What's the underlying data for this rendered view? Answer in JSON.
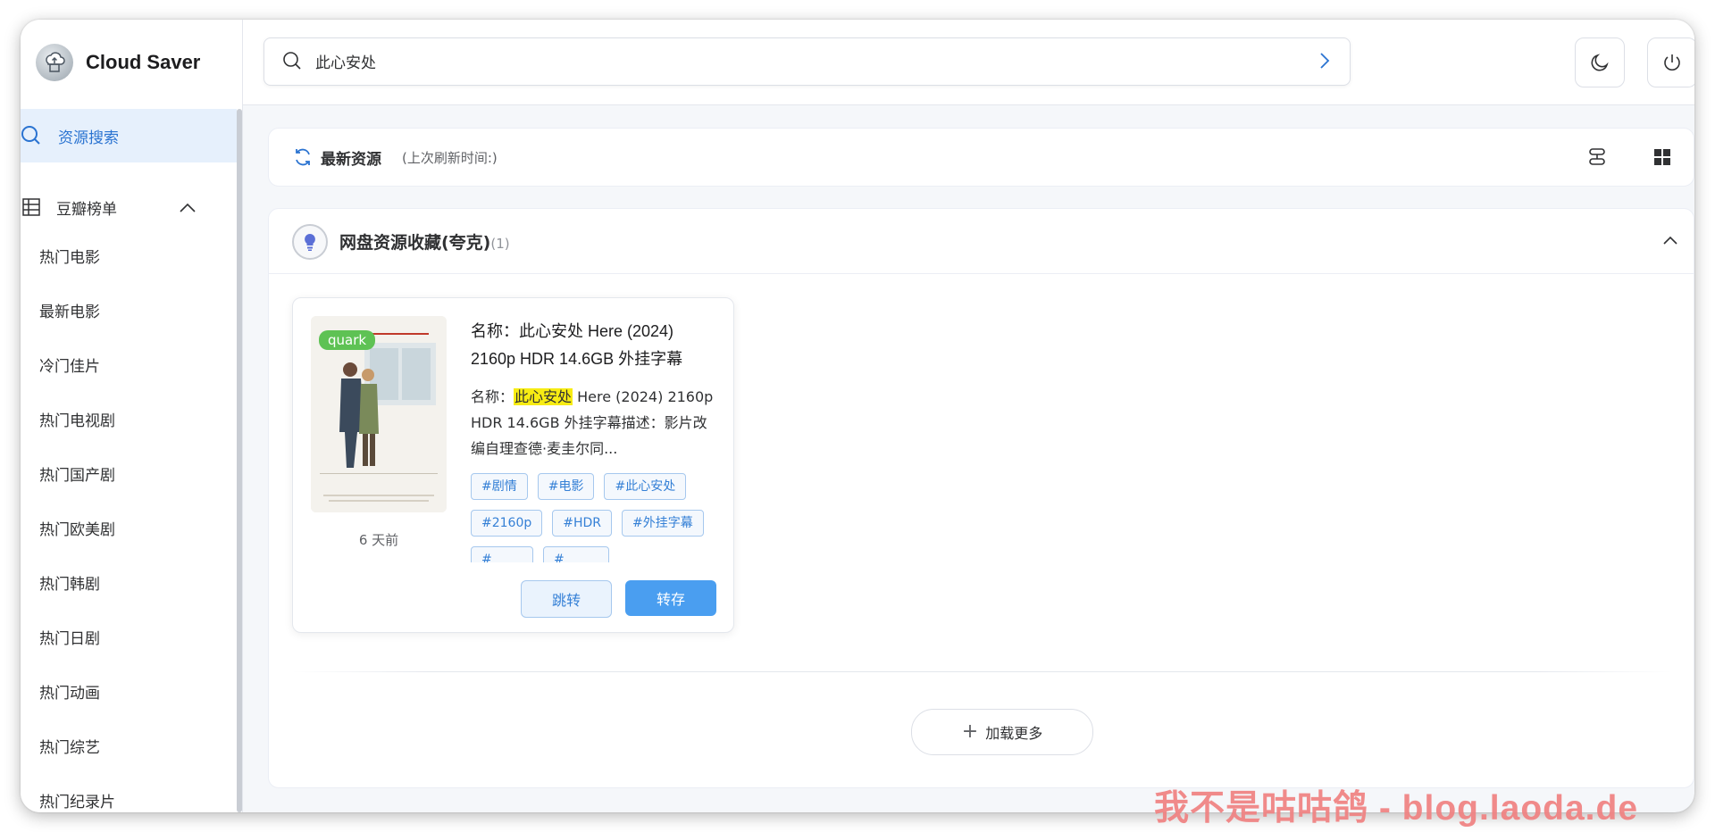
{
  "app": {
    "name": "Cloud Saver"
  },
  "sidebar": {
    "active": {
      "label": "资源搜索",
      "icon": "search-icon"
    },
    "group": {
      "label": "豆瓣榜单",
      "icon": "table-icon",
      "expanded": true
    },
    "items": [
      {
        "label": "热门电影"
      },
      {
        "label": "最新电影"
      },
      {
        "label": "冷门佳片"
      },
      {
        "label": "热门电视剧"
      },
      {
        "label": "热门国产剧"
      },
      {
        "label": "热门欧美剧"
      },
      {
        "label": "热门韩剧"
      },
      {
        "label": "热门日剧"
      },
      {
        "label": "热门动画"
      },
      {
        "label": "热门综艺"
      },
      {
        "label": "热门纪录片"
      }
    ]
  },
  "search": {
    "value": "此心安处"
  },
  "header_buttons": {
    "theme": "moon-icon",
    "logout": "power-icon"
  },
  "latest": {
    "title": "最新资源",
    "subtitle": "(上次刷新时间:)"
  },
  "panel": {
    "title": "网盘资源收藏(夸克)",
    "count": "(1)",
    "result": {
      "badge": "quark",
      "age": "6 天前",
      "title": "名称：此心安处 Here (2024) 2160p HDR 14.6GB 外挂字幕",
      "desc_prefix": "名称：",
      "desc_highlight": "此心安处",
      "desc_rest": " Here (2024) 2160p HDR 14.6GB 外挂字幕描述：影片改编自理查德·麦圭尔同...",
      "tags": [
        "#剧情",
        "#电影",
        "#此心安处",
        "#2160p",
        "#HDR",
        "#外挂字幕",
        "#",
        "#"
      ],
      "jump_label": "跳转",
      "save_label": "转存"
    },
    "load_more": "加载更多"
  },
  "watermark": "我不是咕咕鸽 - blog.laoda.de",
  "colors": {
    "accent": "#4a9ef0",
    "active_bg": "#e6f0fc",
    "badge": "#5ec254",
    "highlight": "#f7ec13",
    "watermark": "#f08181"
  }
}
